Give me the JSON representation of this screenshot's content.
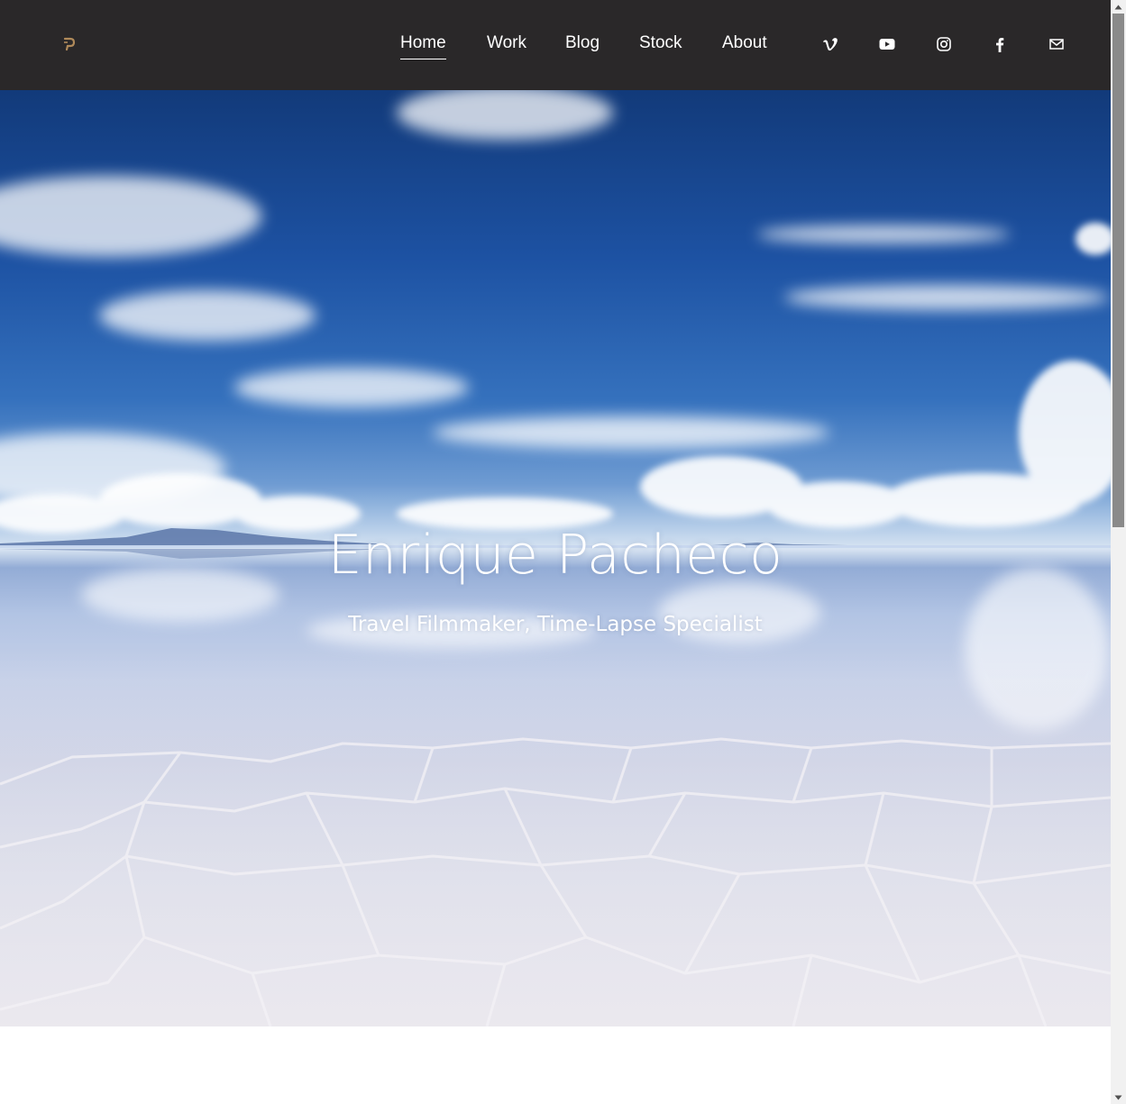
{
  "brand": {
    "logo_icon": "ep-monogram-logo",
    "accent_color": "#b08a5a"
  },
  "nav": {
    "items": [
      {
        "label": "Home",
        "active": true
      },
      {
        "label": "Work",
        "active": false
      },
      {
        "label": "Blog",
        "active": false
      },
      {
        "label": "Stock",
        "active": false
      },
      {
        "label": "About",
        "active": false
      }
    ]
  },
  "social": {
    "icons": [
      "vimeo-icon",
      "youtube-icon",
      "instagram-icon",
      "facebook-icon",
      "mail-icon"
    ]
  },
  "hero": {
    "title": "Enrique Pacheco",
    "subtitle": "Travel Filmmaker, Time-Lapse Specialist",
    "background": "salt-flat-sky-reflection-photo"
  },
  "colors": {
    "header_bg": "#2a2829",
    "nav_text": "#ffffff",
    "page_bg": "#ffffff"
  }
}
